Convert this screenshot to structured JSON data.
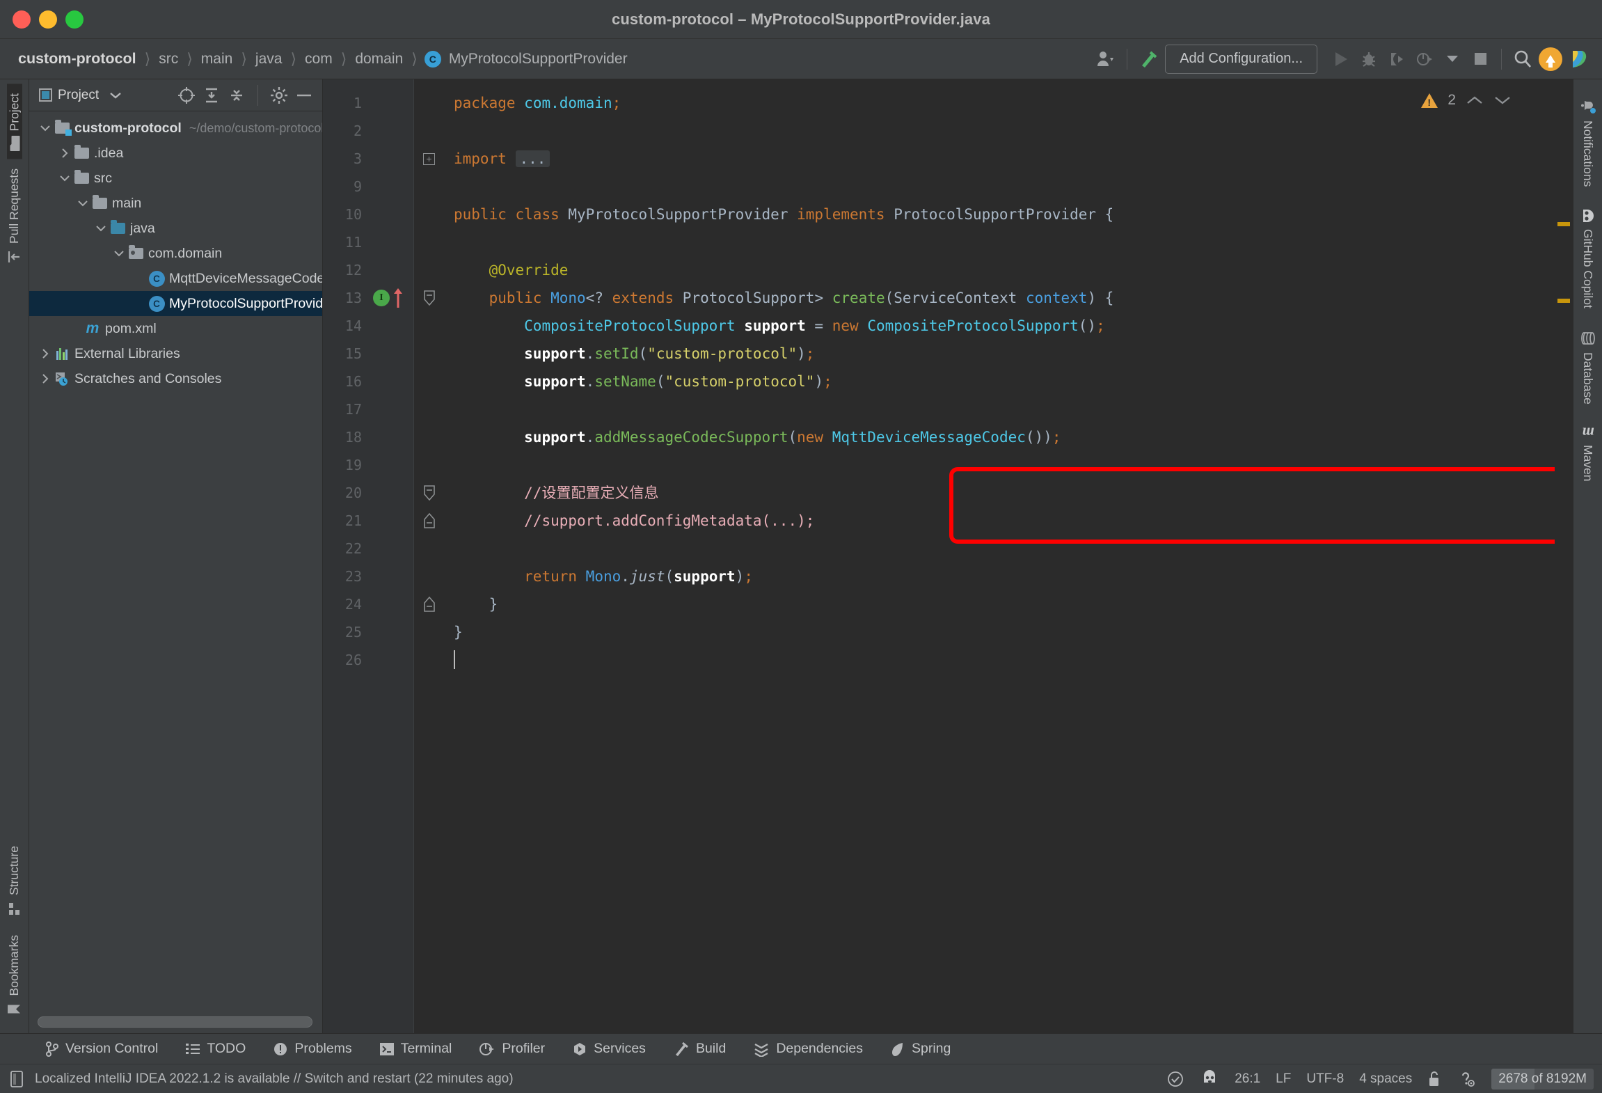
{
  "window": {
    "title": "custom-protocol – MyProtocolSupportProvider.java",
    "traffic_lights": [
      "close",
      "minimize",
      "zoom"
    ]
  },
  "breadcrumb": {
    "items": [
      "custom-protocol",
      "src",
      "main",
      "java",
      "com",
      "domain"
    ],
    "file": "MyProtocolSupportProvider",
    "file_badge": "C"
  },
  "toolbar": {
    "add_configuration_label": "Add Configuration...",
    "icons": [
      "user-account-icon",
      "build-hammer-icon",
      "run-icon",
      "debug-icon",
      "run-coverage-icon",
      "profile-icon",
      "stop-icon",
      "search-everywhere-icon",
      "update-icon",
      "copilot-icon"
    ]
  },
  "left_strip": {
    "top": [
      {
        "label": "Project",
        "icon": "project-folder-icon",
        "active": true
      },
      {
        "label": "Pull Requests",
        "icon": "pull-request-icon",
        "active": false
      }
    ],
    "bottom": [
      {
        "label": "Structure",
        "icon": "structure-icon",
        "active": false
      },
      {
        "label": "Bookmarks",
        "icon": "bookmark-icon",
        "active": false
      }
    ]
  },
  "right_strip": [
    {
      "label": "Notifications",
      "icon": "bell-icon"
    },
    {
      "label": "GitHub Copilot",
      "icon": "copilot-icon"
    },
    {
      "label": "Database",
      "icon": "database-icon"
    },
    {
      "label": "Maven",
      "icon": "maven-icon"
    }
  ],
  "project_panel": {
    "title": "Project",
    "header_icons": [
      "select-opened-file-icon",
      "expand-all-icon",
      "collapse-all-icon",
      "settings-gear-icon",
      "hide-icon"
    ],
    "tree": [
      {
        "depth": 0,
        "arrow": "down",
        "icon": "module-folder-icon",
        "label": "custom-protocol",
        "bold": true,
        "path": "~/demo/custom-protocol",
        "selected": false
      },
      {
        "depth": 1,
        "arrow": "right",
        "icon": "folder-icon",
        "label": ".idea",
        "bold": false,
        "path": "",
        "selected": false
      },
      {
        "depth": 1,
        "arrow": "down",
        "icon": "folder-icon",
        "label": "src",
        "bold": false,
        "path": "",
        "selected": false
      },
      {
        "depth": 2,
        "arrow": "down",
        "icon": "folder-icon",
        "label": "main",
        "bold": false,
        "path": "",
        "selected": false
      },
      {
        "depth": 3,
        "arrow": "down",
        "icon": "source-folder-icon",
        "label": "java",
        "bold": false,
        "path": "",
        "selected": false
      },
      {
        "depth": 4,
        "arrow": "down",
        "icon": "package-icon",
        "label": "com.domain",
        "bold": false,
        "path": "",
        "selected": false
      },
      {
        "depth": 5,
        "arrow": "none",
        "icon": "java-class-icon",
        "label": "MqttDeviceMessageCodec",
        "bold": false,
        "path": "",
        "selected": false
      },
      {
        "depth": 5,
        "arrow": "none",
        "icon": "java-class-icon",
        "label": "MyProtocolSupportProvider",
        "bold": false,
        "path": "",
        "selected": true
      },
      {
        "depth": 2,
        "arrow": "none",
        "icon": "maven-pom-icon",
        "label": "pom.xml",
        "bold": false,
        "path": "",
        "selected": false
      },
      {
        "depth": 0,
        "arrow": "right",
        "icon": "libraries-icon",
        "label": "External Libraries",
        "bold": false,
        "path": "",
        "selected": false
      },
      {
        "depth": 0,
        "arrow": "right",
        "icon": "scratches-icon",
        "label": "Scratches and Consoles",
        "bold": false,
        "path": "",
        "selected": false
      }
    ]
  },
  "editor": {
    "inspection_warning_count": "2",
    "caret_line_number": 26,
    "line_numbers": [
      1,
      2,
      3,
      9,
      10,
      11,
      12,
      13,
      14,
      15,
      16,
      17,
      18,
      19,
      20,
      21,
      22,
      23,
      24,
      25,
      26
    ],
    "gutter_icons": {
      "line_13": [
        "implements-method-icon",
        "override-arrow-icon"
      ]
    },
    "fold_markers": [
      3,
      13,
      20,
      21,
      24
    ],
    "highlight_box": {
      "color": "#fe0000",
      "target_line": 18
    },
    "code_lines": [
      "package com.domain;",
      "",
      "import ...",
      "",
      "public class MyProtocolSupportProvider implements ProtocolSupportProvider {",
      "",
      "    @Override",
      "    public Mono<? extends ProtocolSupport> create(ServiceContext context) {",
      "        CompositeProtocolSupport support = new CompositeProtocolSupport();",
      "        support.setId(\"custom-protocol\");",
      "        support.setName(\"custom-protocol\");",
      "",
      "        support.addMessageCodecSupport(new MqttDeviceMessageCodec());",
      "",
      "        //设置配置定义信息",
      "        //support.addConfigMetadata(...);",
      "",
      "        return Mono.just(support);",
      "    }",
      "}",
      ""
    ]
  },
  "tool_windows": [
    {
      "label": "Version Control",
      "icon": "branch-icon"
    },
    {
      "label": "TODO",
      "icon": "todo-list-icon"
    },
    {
      "label": "Problems",
      "icon": "problems-icon"
    },
    {
      "label": "Terminal",
      "icon": "terminal-icon"
    },
    {
      "label": "Profiler",
      "icon": "profiler-icon"
    },
    {
      "label": "Services",
      "icon": "services-icon"
    },
    {
      "label": "Build",
      "icon": "build-hammer-icon"
    },
    {
      "label": "Dependencies",
      "icon": "dependencies-icon"
    },
    {
      "label": "Spring",
      "icon": "spring-leaf-icon"
    }
  ],
  "status_bar": {
    "message": "Localized IntelliJ IDEA 2022.1.2 is available // Switch and restart (22 minutes ago)",
    "message_icon": "ide-notification-icon",
    "caret_position": "26:1",
    "line_separator": "LF",
    "encoding": "UTF-8",
    "indent": "4 spaces",
    "lock_icon": "unlocked-icon",
    "inspection_icon": "inspections-widget-icon",
    "event_log_icon": "event-log-icon",
    "memory": "2678 of 8192M"
  },
  "colors": {
    "ui_bg": "#3c3f41",
    "editor_bg": "#2b2b2b",
    "gutter_bg": "#313335",
    "selection": "#0d293e",
    "accent_blue": "#3b8fc4",
    "highlight_red": "#fe0000",
    "warning_yellow": "#e8a33d"
  }
}
